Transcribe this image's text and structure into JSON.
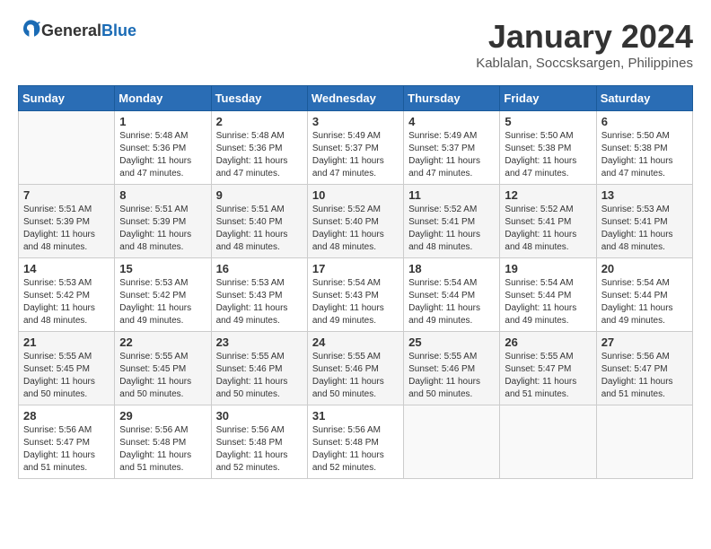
{
  "header": {
    "logo_general": "General",
    "logo_blue": "Blue",
    "month_year": "January 2024",
    "location": "Kablalan, Soccsksargen, Philippines"
  },
  "days_of_week": [
    "Sunday",
    "Monday",
    "Tuesday",
    "Wednesday",
    "Thursday",
    "Friday",
    "Saturday"
  ],
  "weeks": [
    [
      {
        "day": "",
        "info": ""
      },
      {
        "day": "1",
        "info": "Sunrise: 5:48 AM\nSunset: 5:36 PM\nDaylight: 11 hours\nand 47 minutes."
      },
      {
        "day": "2",
        "info": "Sunrise: 5:48 AM\nSunset: 5:36 PM\nDaylight: 11 hours\nand 47 minutes."
      },
      {
        "day": "3",
        "info": "Sunrise: 5:49 AM\nSunset: 5:37 PM\nDaylight: 11 hours\nand 47 minutes."
      },
      {
        "day": "4",
        "info": "Sunrise: 5:49 AM\nSunset: 5:37 PM\nDaylight: 11 hours\nand 47 minutes."
      },
      {
        "day": "5",
        "info": "Sunrise: 5:50 AM\nSunset: 5:38 PM\nDaylight: 11 hours\nand 47 minutes."
      },
      {
        "day": "6",
        "info": "Sunrise: 5:50 AM\nSunset: 5:38 PM\nDaylight: 11 hours\nand 47 minutes."
      }
    ],
    [
      {
        "day": "7",
        "info": "Sunrise: 5:51 AM\nSunset: 5:39 PM\nDaylight: 11 hours\nand 48 minutes."
      },
      {
        "day": "8",
        "info": "Sunrise: 5:51 AM\nSunset: 5:39 PM\nDaylight: 11 hours\nand 48 minutes."
      },
      {
        "day": "9",
        "info": "Sunrise: 5:51 AM\nSunset: 5:40 PM\nDaylight: 11 hours\nand 48 minutes."
      },
      {
        "day": "10",
        "info": "Sunrise: 5:52 AM\nSunset: 5:40 PM\nDaylight: 11 hours\nand 48 minutes."
      },
      {
        "day": "11",
        "info": "Sunrise: 5:52 AM\nSunset: 5:41 PM\nDaylight: 11 hours\nand 48 minutes."
      },
      {
        "day": "12",
        "info": "Sunrise: 5:52 AM\nSunset: 5:41 PM\nDaylight: 11 hours\nand 48 minutes."
      },
      {
        "day": "13",
        "info": "Sunrise: 5:53 AM\nSunset: 5:41 PM\nDaylight: 11 hours\nand 48 minutes."
      }
    ],
    [
      {
        "day": "14",
        "info": "Sunrise: 5:53 AM\nSunset: 5:42 PM\nDaylight: 11 hours\nand 48 minutes."
      },
      {
        "day": "15",
        "info": "Sunrise: 5:53 AM\nSunset: 5:42 PM\nDaylight: 11 hours\nand 49 minutes."
      },
      {
        "day": "16",
        "info": "Sunrise: 5:53 AM\nSunset: 5:43 PM\nDaylight: 11 hours\nand 49 minutes."
      },
      {
        "day": "17",
        "info": "Sunrise: 5:54 AM\nSunset: 5:43 PM\nDaylight: 11 hours\nand 49 minutes."
      },
      {
        "day": "18",
        "info": "Sunrise: 5:54 AM\nSunset: 5:44 PM\nDaylight: 11 hours\nand 49 minutes."
      },
      {
        "day": "19",
        "info": "Sunrise: 5:54 AM\nSunset: 5:44 PM\nDaylight: 11 hours\nand 49 minutes."
      },
      {
        "day": "20",
        "info": "Sunrise: 5:54 AM\nSunset: 5:44 PM\nDaylight: 11 hours\nand 49 minutes."
      }
    ],
    [
      {
        "day": "21",
        "info": "Sunrise: 5:55 AM\nSunset: 5:45 PM\nDaylight: 11 hours\nand 50 minutes."
      },
      {
        "day": "22",
        "info": "Sunrise: 5:55 AM\nSunset: 5:45 PM\nDaylight: 11 hours\nand 50 minutes."
      },
      {
        "day": "23",
        "info": "Sunrise: 5:55 AM\nSunset: 5:46 PM\nDaylight: 11 hours\nand 50 minutes."
      },
      {
        "day": "24",
        "info": "Sunrise: 5:55 AM\nSunset: 5:46 PM\nDaylight: 11 hours\nand 50 minutes."
      },
      {
        "day": "25",
        "info": "Sunrise: 5:55 AM\nSunset: 5:46 PM\nDaylight: 11 hours\nand 50 minutes."
      },
      {
        "day": "26",
        "info": "Sunrise: 5:55 AM\nSunset: 5:47 PM\nDaylight: 11 hours\nand 51 minutes."
      },
      {
        "day": "27",
        "info": "Sunrise: 5:56 AM\nSunset: 5:47 PM\nDaylight: 11 hours\nand 51 minutes."
      }
    ],
    [
      {
        "day": "28",
        "info": "Sunrise: 5:56 AM\nSunset: 5:47 PM\nDaylight: 11 hours\nand 51 minutes."
      },
      {
        "day": "29",
        "info": "Sunrise: 5:56 AM\nSunset: 5:48 PM\nDaylight: 11 hours\nand 51 minutes."
      },
      {
        "day": "30",
        "info": "Sunrise: 5:56 AM\nSunset: 5:48 PM\nDaylight: 11 hours\nand 52 minutes."
      },
      {
        "day": "31",
        "info": "Sunrise: 5:56 AM\nSunset: 5:48 PM\nDaylight: 11 hours\nand 52 minutes."
      },
      {
        "day": "",
        "info": ""
      },
      {
        "day": "",
        "info": ""
      },
      {
        "day": "",
        "info": ""
      }
    ]
  ]
}
